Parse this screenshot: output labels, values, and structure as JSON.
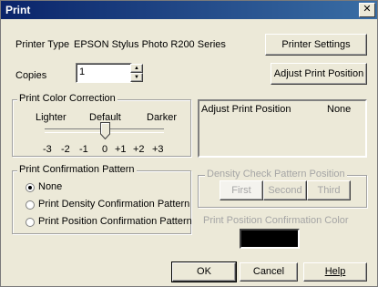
{
  "window": {
    "title": "Print",
    "close_glyph": "✕"
  },
  "printer": {
    "label": "Printer Type",
    "value": "EPSON Stylus Photo R200 Series",
    "settings_button": "Printer Settings"
  },
  "copies": {
    "label": "Copies",
    "value": "1",
    "up_glyph": "▲",
    "down_glyph": "▼"
  },
  "adjust_button": "Adjust Print Position",
  "color_correction": {
    "title": "Print Color Correction",
    "lighter": "Lighter",
    "default": "Default",
    "darker": "Darker",
    "ticks": [
      "-3",
      "-2",
      "-1",
      "0",
      "+1",
      "+2",
      "+3"
    ],
    "selected": "0"
  },
  "adjust_panel": {
    "label": "Adjust Print Position",
    "value": "None"
  },
  "confirmation": {
    "title": "Print Confirmation Pattern",
    "options": [
      "None",
      "Print Density Confirmation Pattern",
      "Print Position Confirmation Pattern"
    ],
    "selected_index": 0
  },
  "density_check": {
    "title": "Density Check Pattern Position",
    "buttons": [
      "First",
      "Second",
      "Third"
    ]
  },
  "position_color": {
    "title": "Print Position Confirmation Color",
    "swatch": "#000000"
  },
  "footer": {
    "ok": "OK",
    "cancel": "Cancel",
    "help": "Help"
  }
}
